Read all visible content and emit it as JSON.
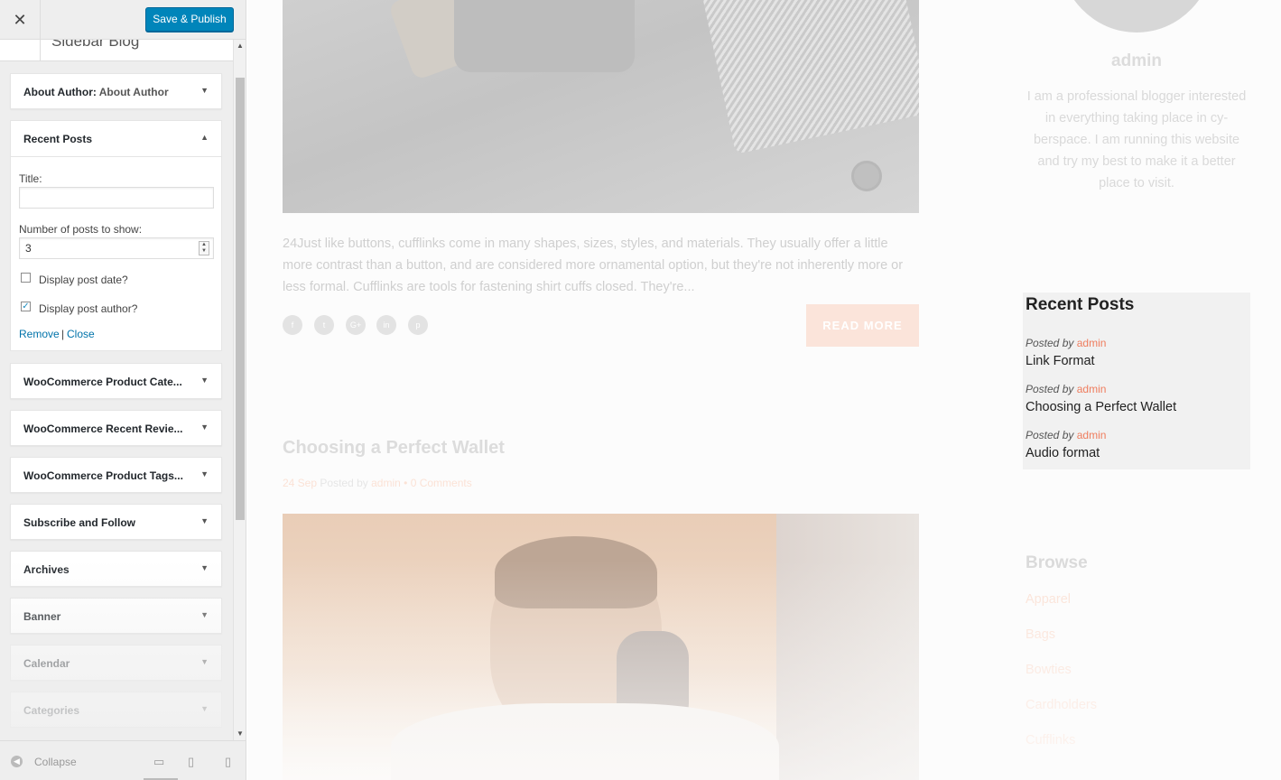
{
  "customizer": {
    "close_label": "✕",
    "save_button": "Save & Publish",
    "section_title": "Sidebar Blog",
    "widgets_top": [
      {
        "title": "About Author:",
        "subtitle": "About Author"
      }
    ],
    "recent_posts_widget": {
      "title": "Recent Posts",
      "title_field_label": "Title:",
      "title_field_value": "",
      "num_posts_label": "Number of posts to show:",
      "num_posts_value": "3",
      "display_date_label": "Display post date?",
      "display_date_checked": false,
      "display_author_label": "Display post author?",
      "display_author_checked": true,
      "remove_label": "Remove",
      "separator": "|",
      "close_label": "Close"
    },
    "widgets_bottom": [
      {
        "title": "WooCommerce Product Cate..."
      },
      {
        "title": "WooCommerce Recent Revie..."
      },
      {
        "title": "WooCommerce Product Tags..."
      },
      {
        "title": "Subscribe and Follow"
      },
      {
        "title": "Archives"
      },
      {
        "title": "Banner"
      },
      {
        "title": "Calendar"
      },
      {
        "title": "Categories"
      }
    ],
    "footer": {
      "collapse_label": "Collapse",
      "devices": [
        "desktop-icon",
        "tablet-icon",
        "mobile-icon"
      ]
    }
  },
  "preview": {
    "post1_excerpt": "24Just like buttons, cufflinks come in many shapes, sizes, styles, and materials. They usually offer a little more contrast than a button, and are considered more ornamental option, but they're not inherently more or less formal. Cufflinks are tools for fastening shirt cuffs closed. They're...",
    "social_icons": [
      "f",
      "t",
      "G+",
      "in",
      "p"
    ],
    "read_more": "READ MORE",
    "post2_title": "Choosing a Perfect Wallet",
    "post2_meta": {
      "date": "24 Sep",
      "posted_by": "Posted by",
      "author": "admin",
      "dot": "•",
      "comments": "0 Comments"
    },
    "author": {
      "name": "admin",
      "bio": "I am a professional blogger interested in everything taking place in cy-berspace. I am running this website and try my best to make it a better place to visit."
    },
    "recent_posts": {
      "heading": "Recent Posts",
      "posted_by": "Posted by",
      "items": [
        {
          "author": "admin",
          "title": "Link Format"
        },
        {
          "author": "admin",
          "title": "Choosing a Perfect Wallet"
        },
        {
          "author": "admin",
          "title": "Audio format"
        }
      ]
    },
    "browse": {
      "heading": "Browse",
      "items": [
        "Apparel",
        "Bags",
        "Bowties",
        "Cardholders",
        "Cufflinks"
      ]
    }
  },
  "colors": {
    "primary_button": "#0085ba",
    "link": "#0073aa",
    "accent": "#ef7d5e"
  }
}
